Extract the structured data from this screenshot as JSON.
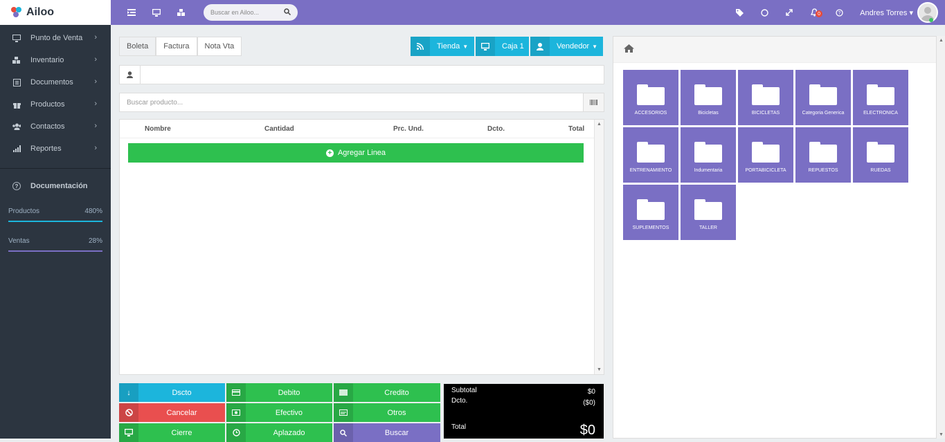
{
  "brand": {
    "name": "Ailoo"
  },
  "sidebar": {
    "items": [
      {
        "label": "Punto de Venta",
        "icon": "monitor-icon"
      },
      {
        "label": "Inventario",
        "icon": "boxes-icon"
      },
      {
        "label": "Documentos",
        "icon": "list-icon"
      },
      {
        "label": "Productos",
        "icon": "gift-icon"
      },
      {
        "label": "Contactos",
        "icon": "users-icon"
      },
      {
        "label": "Reportes",
        "icon": "bar-chart-icon"
      }
    ],
    "documentation": "Documentación",
    "stats": [
      {
        "label": "Productos",
        "value": "480%",
        "color": "#1cb5dc"
      },
      {
        "label": "Ventas",
        "value": "28%",
        "color": "#7a6fc4"
      }
    ]
  },
  "topbar": {
    "search_placeholder": "Buscar en Ailoo...",
    "notifications": "0",
    "user": "Andres Torres",
    "colors": {
      "accent": "#7a6fc4"
    }
  },
  "pos": {
    "tabs": [
      "Boleta",
      "Factura",
      "Nota Vta"
    ],
    "store_label": "Tienda",
    "register_label": "Caja 1",
    "seller_label": "Vendedor",
    "product_placeholder": "Buscar producto...",
    "columns": [
      "Nombre",
      "Cantidad",
      "Prc. Und.",
      "Dcto.",
      "Total"
    ],
    "add_line": "Agregar Linea",
    "buttons": {
      "dscto": "Dscto",
      "debito": "Debito",
      "credito": "Credito",
      "cancelar": "Cancelar",
      "efectivo": "Efectivo",
      "otros": "Otros",
      "cierre": "Cierre",
      "aplazado": "Aplazado",
      "buscar": "Buscar"
    },
    "totals": {
      "subtotal_label": "Subtotal",
      "subtotal": "$0",
      "dcto_label": "Dcto.",
      "dcto": "($0)",
      "total_label": "Total",
      "total": "$0"
    }
  },
  "categories": [
    "ACCESORIOS",
    "Bicicletas",
    "BICICLETAS",
    "Categoria Generica",
    "ELECTRONICA",
    "ENTRENAMIENTO",
    "Indumentaria",
    "PORTABICICLETA",
    "REPUESTOS",
    "RUEDAS",
    "SUPLEMENTOS",
    "TALLER"
  ]
}
